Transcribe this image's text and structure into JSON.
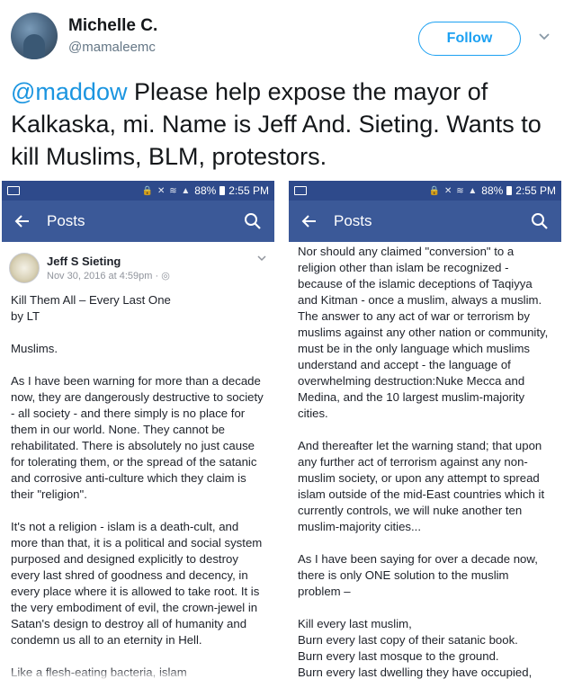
{
  "tweet": {
    "author_name": "Michelle C.",
    "author_handle": "@mamaleemc",
    "follow_label": "Follow",
    "mention": "@maddow",
    "text": " Please help expose the mayor of Kalkaska, mi. Name is Jeff And. Sieting. Wants to kill Muslims, BLM, protestors."
  },
  "colors": {
    "status_bar": "#2e4a8b",
    "app_bar": "#3b5998",
    "link_blue": "#1b95e0",
    "follow_blue": "#1da1f2"
  },
  "status_bar": {
    "battery": "88%",
    "time": "2:55 PM",
    "signal": "🔒 ✕ ≋ ▲"
  },
  "left_screen": {
    "app_title": "Posts",
    "post_author": "Jeff S Sieting",
    "post_date": "Nov 30, 2016 at 4:59pm · ◎",
    "paragraphs": [
      "Kill Them All – Every Last One\nby LT",
      "Muslims.",
      "As I have been warning for more than a decade now, they are dangerously destructive to society - all society - and there simply is no place for them in our world.  None.  They cannot be rehabilitated.  There is absolutely no just cause for tolerating them, or the spread of the satanic and corrosive anti-culture which they claim is their \"religion\".",
      "It's not a religion - islam is a death-cult, and more than that, it is a political and social system purposed and designed explicitly to destroy every last shred of goodness and decency, in every place where it is allowed to take root. It is the very embodiment of evil, the crown-jewel in Satan's design to destroy all of humanity and condemn us all to an eternity in Hell.",
      "Like a flesh-eating bacteria, islam"
    ]
  },
  "right_screen": {
    "app_title": "Posts",
    "paragraphs": [
      "Nor should any claimed \"conversion\" to a religion other than islam be recognized - because of the islamic deceptions of Taqiyya and Kitman - once a muslim, always a muslim. The answer to any act of war or terrorism by muslims against any other nation or community, must be in the only language which muslims understand and accept - the language of overwhelming destruction:Nuke Mecca and Medina, and the 10 largest muslim-majority cities.",
      "And thereafter let the warning stand; that upon any further act of terrorism against any non-muslim society, or upon any attempt to spread islam outside of the mid-East countries which it currently controls, we will nuke another ten muslim-majority cities...",
      "As I have been saying for over a decade now, there is only ONE solution to the muslim problem –",
      "Kill every last muslim,\nBurn every last copy of their satanic book.\nBurn every last mosque to the ground.\nBurn every last dwelling they have occupied,\nAnd wherever you must burn,"
    ]
  }
}
